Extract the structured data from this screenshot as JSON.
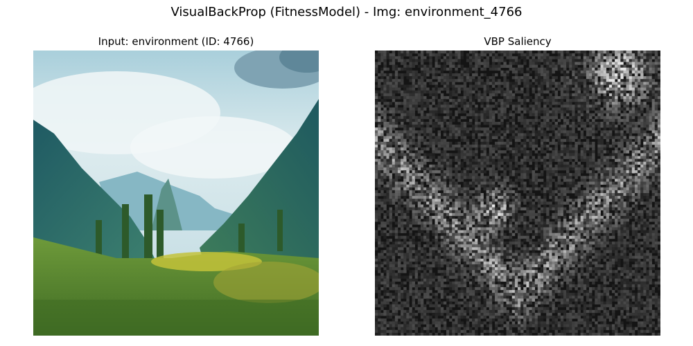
{
  "figure": {
    "title": "VisualBackProp (FitnessModel) - Img: environment_4766"
  },
  "panels": [
    {
      "title": "Input: environment (ID: 4766)",
      "content": "landscape-photo"
    },
    {
      "title": "VBP Saliency",
      "content": "saliency-map"
    }
  ],
  "colors": {
    "background": "#ffffff",
    "sky": "#cfe3ea",
    "mountain": "#2f6f70",
    "grass": "#5f8b2e",
    "saliency_background": "#1a1a1a"
  }
}
